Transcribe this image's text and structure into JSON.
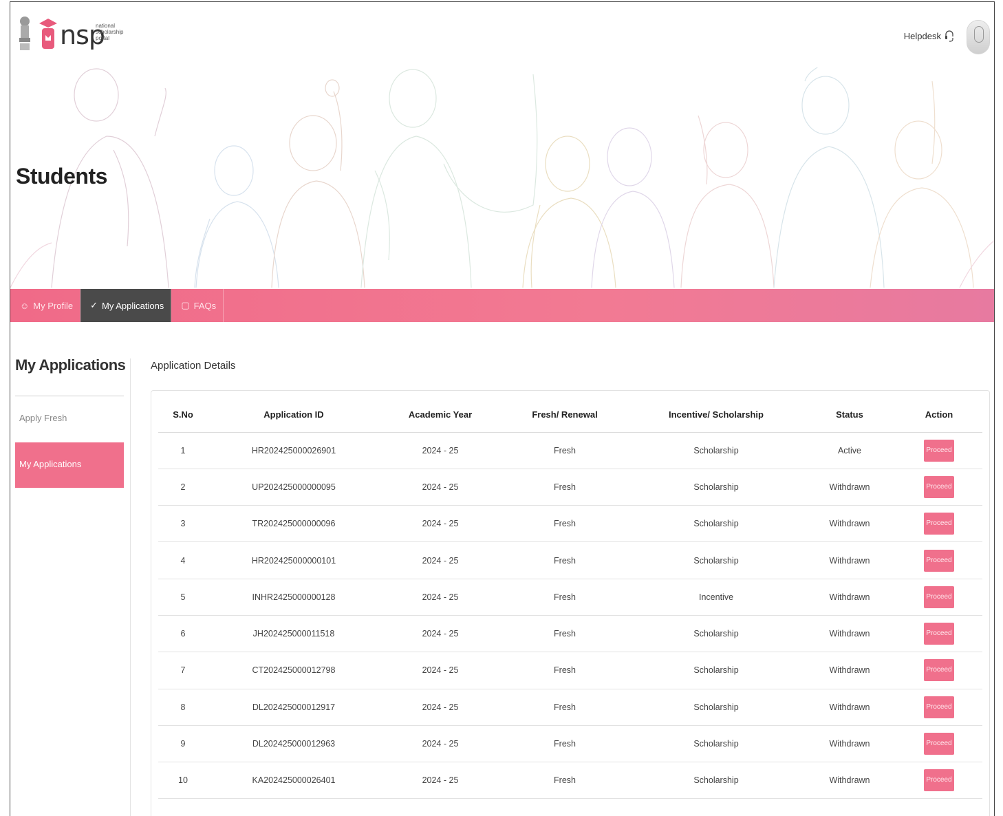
{
  "header": {
    "logo_text": "nsp",
    "logo_sub": [
      "national",
      "scholarship",
      "portal"
    ],
    "helpdesk_label": "Helpdesk"
  },
  "hero": {
    "title": "Students"
  },
  "nav": {
    "tabs": [
      {
        "label": "My Profile",
        "icon": "user-icon",
        "active": false
      },
      {
        "label": "My Applications",
        "icon": "check-circle-icon",
        "active": true
      },
      {
        "label": "FAQs",
        "icon": "chat-icon",
        "active": false
      }
    ]
  },
  "sidebar": {
    "title": "My Applications",
    "items": [
      {
        "label": "Apply Fresh",
        "active": false
      },
      {
        "label": "My Applications",
        "active": true
      }
    ]
  },
  "main": {
    "section_title": "Application Details",
    "table": {
      "headers": [
        "S.No",
        "Application ID",
        "Academic Year",
        "Fresh/ Renewal",
        "Incentive/ Scholarship",
        "Status",
        "Action"
      ],
      "rows": [
        {
          "sno": "1",
          "app_id": "HR202425000026901",
          "year": "2024 - 25",
          "type": "Fresh",
          "category": "Scholarship",
          "status": "Active",
          "action": "Proceed"
        },
        {
          "sno": "2",
          "app_id": "UP202425000000095",
          "year": "2024 - 25",
          "type": "Fresh",
          "category": "Scholarship",
          "status": "Withdrawn",
          "action": "Proceed"
        },
        {
          "sno": "3",
          "app_id": "TR202425000000096",
          "year": "2024 - 25",
          "type": "Fresh",
          "category": "Scholarship",
          "status": "Withdrawn",
          "action": "Proceed"
        },
        {
          "sno": "4",
          "app_id": "HR202425000000101",
          "year": "2024 - 25",
          "type": "Fresh",
          "category": "Scholarship",
          "status": "Withdrawn",
          "action": "Proceed"
        },
        {
          "sno": "5",
          "app_id": "INHR2425000000128",
          "year": "2024 - 25",
          "type": "Fresh",
          "category": "Incentive",
          "status": "Withdrawn",
          "action": "Proceed"
        },
        {
          "sno": "6",
          "app_id": "JH202425000011518",
          "year": "2024 - 25",
          "type": "Fresh",
          "category": "Scholarship",
          "status": "Withdrawn",
          "action": "Proceed"
        },
        {
          "sno": "7",
          "app_id": "CT202425000012798",
          "year": "2024 - 25",
          "type": "Fresh",
          "category": "Scholarship",
          "status": "Withdrawn",
          "action": "Proceed"
        },
        {
          "sno": "8",
          "app_id": "DL202425000012917",
          "year": "2024 - 25",
          "type": "Fresh",
          "category": "Scholarship",
          "status": "Withdrawn",
          "action": "Proceed"
        },
        {
          "sno": "9",
          "app_id": "DL202425000012963",
          "year": "2024 - 25",
          "type": "Fresh",
          "category": "Scholarship",
          "status": "Withdrawn",
          "action": "Proceed"
        },
        {
          "sno": "10",
          "app_id": "KA202425000026401",
          "year": "2024 - 25",
          "type": "Fresh",
          "category": "Scholarship",
          "status": "Withdrawn",
          "action": "Proceed"
        }
      ]
    }
  },
  "colors": {
    "accent": "#f0708c",
    "nav_active": "#4a4a4a",
    "text": "#222222"
  }
}
